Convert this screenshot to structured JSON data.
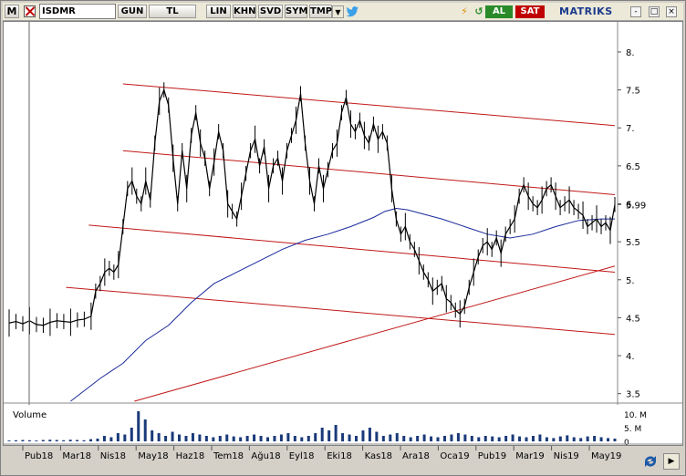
{
  "toolbar": {
    "menu_label": "M",
    "symbol": "ISDMR",
    "buttons": [
      "GUN",
      "TL",
      "LIN",
      "KHN",
      "SVD",
      "SYM",
      "TMP"
    ],
    "dropdown": "▼",
    "buy_label": "AL",
    "sell_label": "SAT",
    "brand": "MATRIKS",
    "window_controls": [
      "-",
      "□",
      "×"
    ]
  },
  "chart": {
    "y_ticks": [
      "8.",
      "7.5",
      "7.",
      "6.5",
      "6.",
      "5.99",
      "5.5",
      "5.",
      "4.5",
      "4.",
      "3.5"
    ],
    "x_ticks": [
      "Pub18",
      "Mar18",
      "Nis18",
      "May18",
      "Haz18",
      "Tem18",
      "Ağu18",
      "Eyl18",
      "Eki18",
      "Kas18",
      "Ara18",
      "Oca19",
      "Pub19",
      "Mar19",
      "Nis19",
      "May19"
    ],
    "last_value": "5.99",
    "volume_label": "Volume",
    "volume_ticks": [
      "10. M",
      "5. M",
      "0"
    ]
  },
  "chart_data": {
    "type": "line",
    "series": [
      {
        "values": [
          [
            0,
            4.43
          ],
          [
            3,
            4.45
          ],
          [
            6,
            4.42
          ],
          [
            9,
            4.46
          ],
          [
            12,
            4.41
          ],
          [
            15,
            4.4
          ],
          [
            18,
            4.44
          ],
          [
            21,
            4.46
          ],
          [
            24,
            4.45
          ],
          [
            27,
            4.44
          ],
          [
            30,
            4.47
          ],
          [
            33,
            4.48
          ],
          [
            36,
            4.52
          ],
          [
            38,
            4.85
          ],
          [
            40,
            4.95
          ],
          [
            42,
            5.1
          ],
          [
            44,
            5.15
          ],
          [
            46,
            5.1
          ],
          [
            48,
            5.2
          ],
          [
            50,
            5.7
          ],
          [
            52,
            6.2
          ],
          [
            54,
            6.3
          ],
          [
            56,
            6.1
          ],
          [
            58,
            6.0
          ],
          [
            60,
            6.3
          ],
          [
            62,
            6.05
          ],
          [
            64,
            6.8
          ],
          [
            66,
            7.35
          ],
          [
            68,
            7.5
          ],
          [
            70,
            7.3
          ],
          [
            72,
            6.6
          ],
          [
            74,
            6.0
          ],
          [
            76,
            6.7
          ],
          [
            78,
            6.2
          ],
          [
            80,
            6.9
          ],
          [
            82,
            7.2
          ],
          [
            84,
            6.8
          ],
          [
            86,
            6.6
          ],
          [
            88,
            6.2
          ],
          [
            90,
            6.55
          ],
          [
            92,
            6.95
          ],
          [
            94,
            6.7
          ],
          [
            96,
            6.0
          ],
          [
            98,
            5.9
          ],
          [
            100,
            5.8
          ],
          [
            102,
            6.1
          ],
          [
            104,
            6.4
          ],
          [
            106,
            6.7
          ],
          [
            108,
            6.85
          ],
          [
            110,
            6.5
          ],
          [
            112,
            6.75
          ],
          [
            114,
            6.2
          ],
          [
            116,
            6.5
          ],
          [
            118,
            6.6
          ],
          [
            120,
            6.3
          ],
          [
            122,
            6.7
          ],
          [
            124,
            6.9
          ],
          [
            126,
            7.1
          ],
          [
            128,
            7.45
          ],
          [
            130,
            6.8
          ],
          [
            132,
            6.3
          ],
          [
            134,
            6.0
          ],
          [
            136,
            6.5
          ],
          [
            138,
            6.2
          ],
          [
            140,
            6.45
          ],
          [
            142,
            6.7
          ],
          [
            144,
            6.8
          ],
          [
            146,
            7.2
          ],
          [
            148,
            7.4
          ],
          [
            150,
            7.05
          ],
          [
            152,
            6.95
          ],
          [
            154,
            7.1
          ],
          [
            156,
            6.9
          ],
          [
            158,
            6.8
          ],
          [
            160,
            7.05
          ],
          [
            162,
            6.85
          ],
          [
            164,
            6.95
          ],
          [
            166,
            6.8
          ],
          [
            168,
            6.2
          ],
          [
            170,
            5.8
          ],
          [
            172,
            5.6
          ],
          [
            174,
            5.7
          ],
          [
            176,
            5.5
          ],
          [
            178,
            5.4
          ],
          [
            180,
            5.25
          ],
          [
            182,
            5.1
          ],
          [
            184,
            5.0
          ],
          [
            186,
            4.85
          ],
          [
            188,
            4.9
          ],
          [
            190,
            4.95
          ],
          [
            192,
            4.75
          ],
          [
            194,
            4.7
          ],
          [
            196,
            4.6
          ],
          [
            198,
            4.55
          ],
          [
            200,
            4.65
          ],
          [
            202,
            4.9
          ],
          [
            204,
            5.1
          ],
          [
            206,
            5.3
          ],
          [
            208,
            5.45
          ],
          [
            210,
            5.5
          ],
          [
            212,
            5.4
          ],
          [
            214,
            5.55
          ],
          [
            216,
            5.35
          ],
          [
            218,
            5.6
          ],
          [
            220,
            5.7
          ],
          [
            222,
            5.8
          ],
          [
            224,
            6.1
          ],
          [
            226,
            6.25
          ],
          [
            228,
            6.1
          ],
          [
            230,
            6.0
          ],
          [
            232,
            5.95
          ],
          [
            234,
            6.05
          ],
          [
            236,
            6.2
          ],
          [
            238,
            6.25
          ],
          [
            240,
            6.1
          ],
          [
            242,
            5.95
          ],
          [
            244,
            6.0
          ],
          [
            246,
            6.05
          ],
          [
            248,
            5.95
          ],
          [
            250,
            5.9
          ],
          [
            252,
            5.85
          ],
          [
            254,
            5.7
          ],
          [
            256,
            5.75
          ],
          [
            258,
            5.8
          ],
          [
            260,
            5.7
          ],
          [
            262,
            5.75
          ],
          [
            264,
            5.65
          ],
          [
            266,
            5.99
          ]
        ]
      },
      {
        "values": [
          [
            27,
            3.4
          ],
          [
            40,
            3.7
          ],
          [
            50,
            3.9
          ],
          [
            60,
            4.2
          ],
          [
            70,
            4.4
          ],
          [
            80,
            4.7
          ],
          [
            90,
            4.95
          ],
          [
            100,
            5.1
          ],
          [
            110,
            5.25
          ],
          [
            120,
            5.4
          ],
          [
            130,
            5.52
          ],
          [
            140,
            5.6
          ],
          [
            150,
            5.7
          ],
          [
            160,
            5.82
          ],
          [
            165,
            5.9
          ],
          [
            170,
            5.94
          ],
          [
            175,
            5.92
          ],
          [
            180,
            5.88
          ],
          [
            190,
            5.8
          ],
          [
            200,
            5.7
          ],
          [
            210,
            5.6
          ],
          [
            220,
            5.55
          ],
          [
            230,
            5.6
          ],
          [
            240,
            5.7
          ],
          [
            250,
            5.78
          ],
          [
            260,
            5.8
          ],
          [
            266,
            5.8
          ]
        ]
      }
    ],
    "channel_lines": [
      {
        "x1": 50,
        "y1": 7.58,
        "x2": 266,
        "y2": 7.03
      },
      {
        "x1": 50,
        "y1": 6.7,
        "x2": 266,
        "y2": 6.12
      },
      {
        "x1": 35,
        "y1": 5.72,
        "x2": 266,
        "y2": 5.1
      },
      {
        "x1": 25,
        "y1": 4.9,
        "x2": 266,
        "y2": 4.28
      },
      {
        "x1": 55,
        "y1": 3.4,
        "x2": 266,
        "y2": 5.18
      }
    ],
    "ylim": [
      3.4,
      8.3
    ],
    "volume_ylim": [
      0,
      12
    ],
    "volume": [
      0.3,
      0.4,
      0.5,
      0.4,
      0.3,
      0.5,
      0.6,
      0.5,
      0.4,
      0.6,
      0.5,
      0.4,
      0.8,
      1.0,
      2.0,
      1.5,
      3.0,
      2.5,
      5.0,
      11.0,
      8.0,
      4.0,
      3.0,
      2.0,
      3.5,
      2.5,
      2.0,
      3.0,
      2.5,
      2.0,
      1.5,
      2.0,
      2.5,
      1.8,
      1.5,
      2.0,
      2.5,
      2.0,
      1.5,
      2.0,
      2.5,
      3.0,
      2.0,
      1.5,
      2.0,
      3.0,
      5.0,
      4.0,
      6.0,
      3.0,
      2.5,
      2.0,
      4.0,
      5.0,
      3.5,
      2.0,
      2.5,
      3.0,
      2.0,
      1.5,
      2.0,
      2.5,
      1.8,
      1.5,
      2.0,
      2.5,
      3.0,
      2.5,
      2.0,
      1.5,
      2.0,
      1.8,
      1.5,
      2.0,
      2.5,
      1.8,
      1.5,
      2.0,
      2.5,
      1.5,
      1.2,
      1.8,
      2.2,
      1.5,
      1.2,
      1.8,
      2.0,
      1.5,
      1.2,
      1.0
    ]
  }
}
